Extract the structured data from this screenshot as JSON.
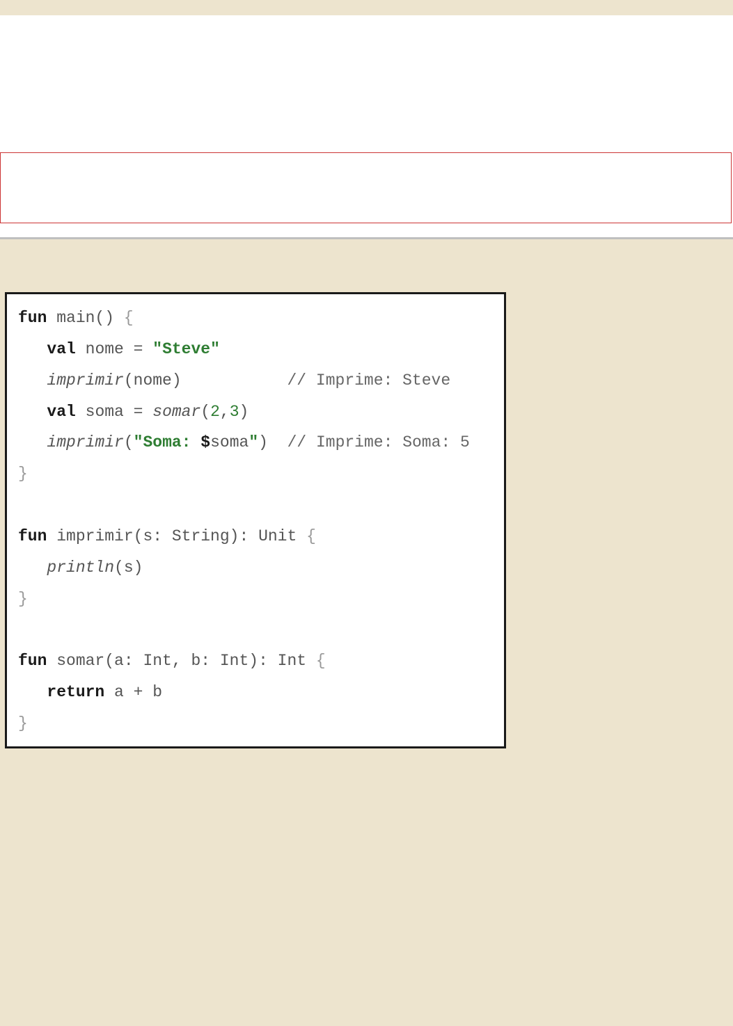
{
  "code": {
    "l1": {
      "kw": "fun",
      "name": " main()",
      "br": " {"
    },
    "l2": {
      "kw": "val",
      "name": " nome = ",
      "q1": "\"",
      "str": "Steve",
      "q2": "\""
    },
    "l3": {
      "call": "imprimir",
      "args": "(nome)",
      "pad": "           ",
      "cmt": "// Imprime: Steve"
    },
    "l4": {
      "kw": "val",
      "name": " soma = ",
      "call": "somar",
      "p1": "(",
      "n1": "2",
      "c": ",",
      "n2": "3",
      "p2": ")"
    },
    "l5": {
      "call": "imprimir",
      "p1": "(",
      "q1": "\"",
      "str1": "Soma: ",
      "dol": "$",
      "var": "soma",
      "q2": "\"",
      "p2": ")  ",
      "cmt": "// Imprime: Soma: 5"
    },
    "l6": {
      "br": "}"
    },
    "l7": {
      "kw": "fun",
      "name": " imprimir(s: String): Unit ",
      "br": "{"
    },
    "l8": {
      "call": "println",
      "args": "(s)"
    },
    "l9": {
      "br": "}"
    },
    "l10": {
      "kw": "fun",
      "name": " somar(a: Int, b: Int): Int ",
      "br": "{"
    },
    "l11": {
      "kw": "return",
      "name": " a + b"
    },
    "l12": {
      "br": "}"
    }
  }
}
